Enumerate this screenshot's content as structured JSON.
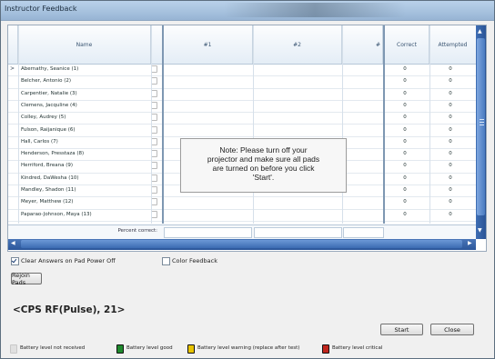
{
  "window": {
    "title": "Instructor Feedback"
  },
  "grid": {
    "headers": {
      "name": "Name",
      "col1": "#1",
      "col2": "#2",
      "col3": "#",
      "correct": "Correct",
      "attempted": "Attempted"
    },
    "rows": [
      {
        "name": "Abernathy, Seanice (1)",
        "correct": "0",
        "attempted": "0",
        "current": true
      },
      {
        "name": "Belcher, Antonio (2)",
        "correct": "0",
        "attempted": "0"
      },
      {
        "name": "Carpentier, Natalie (3)",
        "correct": "0",
        "attempted": "0"
      },
      {
        "name": "Clemens, Jacquline (4)",
        "correct": "0",
        "attempted": "0"
      },
      {
        "name": "Colley, Audrey (5)",
        "correct": "0",
        "attempted": "0"
      },
      {
        "name": "Fulson, Raijanique (6)",
        "correct": "0",
        "attempted": "0"
      },
      {
        "name": "Hall, Carlos (7)",
        "correct": "0",
        "attempted": "0"
      },
      {
        "name": "Henderson, Presstaza (8)",
        "correct": "0",
        "attempted": "0"
      },
      {
        "name": "Herriford, Breana (9)",
        "correct": "0",
        "attempted": "0"
      },
      {
        "name": "Kindred, DaWesha (10)",
        "correct": "0",
        "attempted": "0"
      },
      {
        "name": "Mandley, Shadon (11)",
        "correct": "0",
        "attempted": "0"
      },
      {
        "name": "Meyer, Matthew (12)",
        "correct": "0",
        "attempted": "0"
      },
      {
        "name": "Paparao-Johnson, Maya (13)",
        "correct": "0",
        "attempted": "0"
      }
    ],
    "percent_correct_label": "Percent correct:"
  },
  "note": {
    "line1": "Note: Please turn off your",
    "line2": "projector and make sure all pads",
    "line3": "are turned on before you click",
    "line4": "'Start'."
  },
  "options": {
    "clear_answers": {
      "label": "Clear Answers on Pad Power Off",
      "checked": true
    },
    "color_feedback": {
      "label": "Color Feedback",
      "checked": false
    }
  },
  "buttons": {
    "rejoin": "Rejoin Pads",
    "start": "Start",
    "close": "Close"
  },
  "device_info": "<CPS RF(Pulse), 21>",
  "legend": {
    "not_received": "Battery level not received",
    "good": "Battery level good",
    "warning": "Battery level warning (replace after test)",
    "critical": "Battery level critical"
  },
  "colors": {
    "good": "#1f8a2e",
    "warning": "#e8c400",
    "critical": "#c0261d",
    "scroll": "#2f5fa6"
  }
}
